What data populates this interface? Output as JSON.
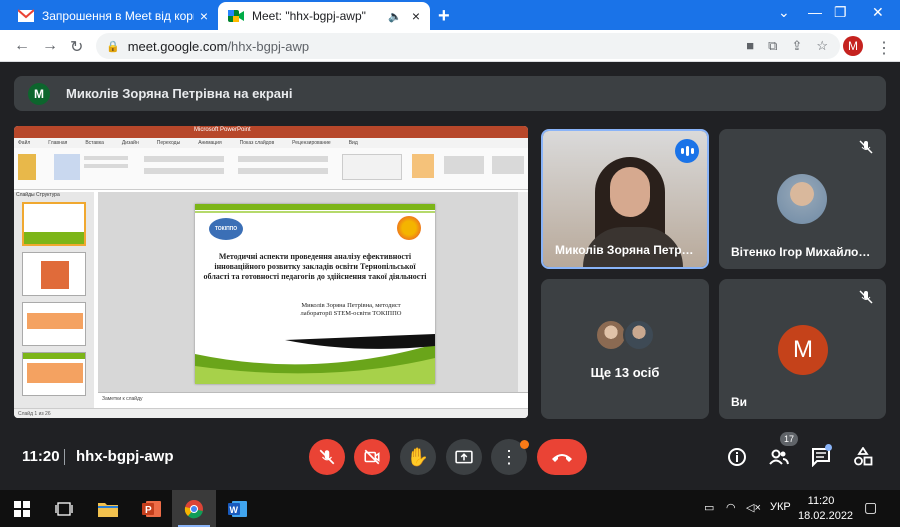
{
  "browser": {
    "tabs": [
      {
        "title": "Запрошення в Meet від користу",
        "favicon": "gmail-icon"
      },
      {
        "title": "Meet: \"hhx-bgpj-awp\"",
        "favicon": "meet-icon",
        "active": true
      }
    ],
    "url_host": "meet.google.com",
    "url_path": "/hhx-bgpj-awp",
    "profile_initial": "M"
  },
  "banner": {
    "avatar_initial": "M",
    "text": "Миколів Зоряна Петрівна на екрані"
  },
  "presentation": {
    "window_title": "Microsoft PowerPoint",
    "ribbon_tabs": [
      "Файл",
      "Главная",
      "Вставка",
      "Дизайн",
      "Переходы",
      "Анимация",
      "Показ слайдов",
      "Рецензирование",
      "Вид"
    ],
    "pane_tabs": "Слайды   Структура",
    "slide_title": "Методичні аспекти проведення аналізу ефективності інноваційного розвитку закладів освіти Тернопільської області та готовності педагогів до здійснення такої діяльності",
    "slide_author": "Миколів Зоряна Петрівна, методист лабораторії STEM-освіти ТОКІППО",
    "logo_text": "ТОКІППО",
    "notes_placeholder": "Заметки к слайду",
    "status": "Слайд 1 из 26"
  },
  "participants": [
    {
      "name": "Миколів Зоряна Петр…",
      "speaking": true
    },
    {
      "name": "Вітенко Ігор Михайло…",
      "muted": true
    },
    {
      "label": "Ще 13 осіб"
    },
    {
      "name": "Ви",
      "avatar_initial": "M",
      "muted": true
    }
  ],
  "bottom_bar": {
    "time": "11:20",
    "meeting_code": "hhx-bgpj-awp",
    "people_count": "17",
    "colors": {
      "red": "#ea4335",
      "gray": "#3c4043"
    }
  },
  "taskbar": {
    "language": "УКР",
    "time": "11:20",
    "date": "18.02.2022"
  }
}
